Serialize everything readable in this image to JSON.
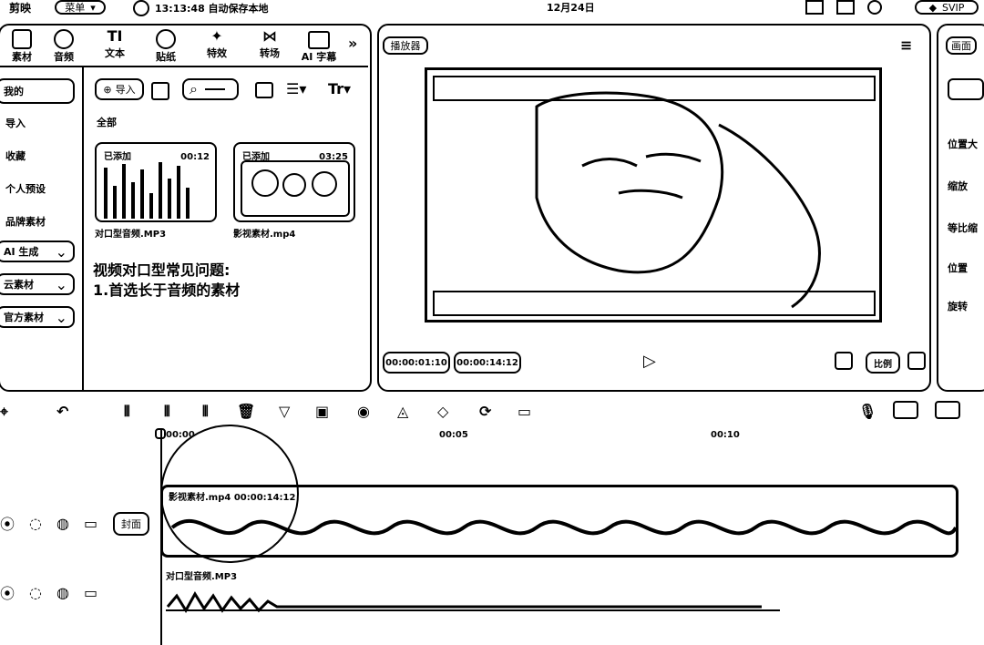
{
  "topbar": {
    "app_name": "剪映",
    "menu_label": "菜单",
    "autosave_text": "13:13:48 自动保存本地",
    "date_text": "12月24日",
    "svip_label": "SVIP"
  },
  "left_tools": [
    {
      "label": "素材"
    },
    {
      "label": "音频"
    },
    {
      "label": "文本"
    },
    {
      "label": "贴纸"
    },
    {
      "label": "特效"
    },
    {
      "label": "转场"
    },
    {
      "label": "AI 字幕"
    }
  ],
  "sidebar": {
    "items": [
      {
        "label": "我的"
      },
      {
        "label": "导入"
      },
      {
        "label": "收藏"
      },
      {
        "label": "个人预设"
      },
      {
        "label": "品牌素材"
      },
      {
        "label": "AI 生成"
      },
      {
        "label": "云素材"
      },
      {
        "label": "官方素材"
      }
    ]
  },
  "media_toolbar": {
    "import_label": "导入",
    "all_label": "全部"
  },
  "media_items": [
    {
      "badge": "已添加",
      "duration": "00:12",
      "name": "对口型音频.MP3"
    },
    {
      "badge": "已添加",
      "duration": "03:25",
      "name": "影视素材.mp4"
    }
  ],
  "overlay_notes": {
    "line1": "视频对口型常见问题:",
    "line2": "1.首选长于音频的素材"
  },
  "player": {
    "title": "播放器",
    "current_time": "00:00:01:10",
    "total_time": "00:00:14:12",
    "ratio_label": "比例"
  },
  "right_panel": {
    "items": [
      {
        "label": "画面"
      },
      {
        "label": "位置大"
      },
      {
        "label": "缩放"
      },
      {
        "label": "等比缩"
      },
      {
        "label": "位置"
      },
      {
        "label": "旋转"
      }
    ]
  },
  "timeline": {
    "ruler": [
      {
        "label": "00:00"
      },
      {
        "label": "00:05"
      },
      {
        "label": "00:10"
      }
    ],
    "cover_label": "封面",
    "video_clip_label": "影视素材.mp4  00:00:14:12",
    "audio_clip_label": "对口型音频.MP3"
  }
}
